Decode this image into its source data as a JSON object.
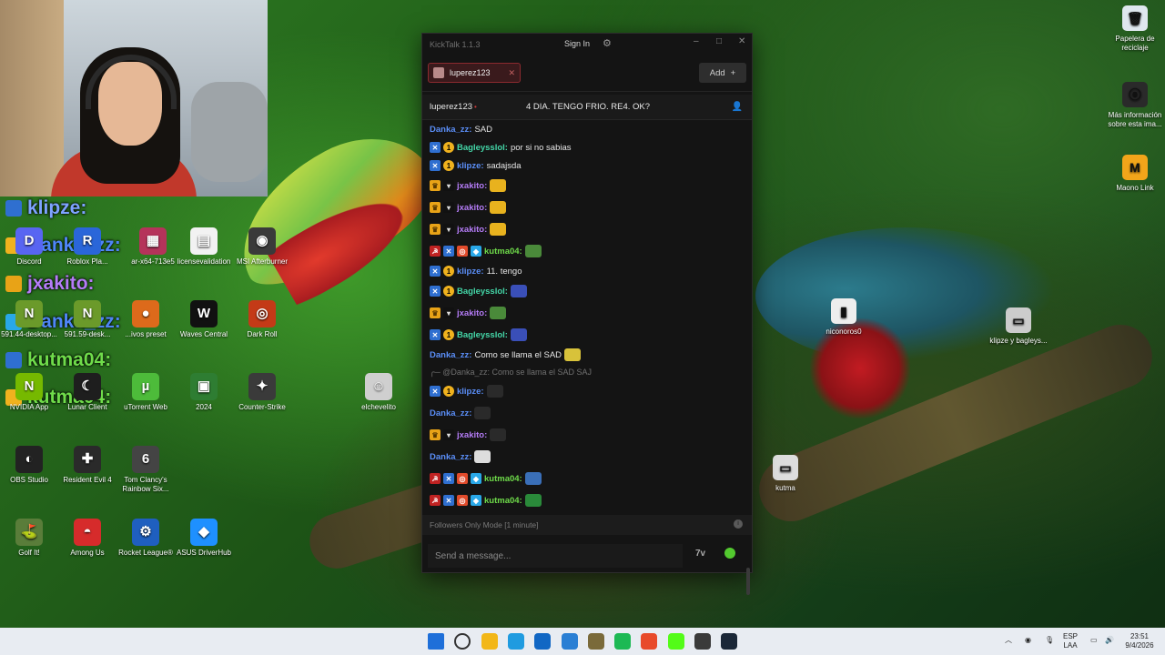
{
  "webcam": {
    "label": "webcam-feed"
  },
  "overlay": {
    "rows": [
      {
        "name": "klipze:",
        "color": "#7ea3ff"
      },
      {
        "name": "Danka_zz:",
        "color": "#4f86f7"
      },
      {
        "name": "jxakito:",
        "color": "#b57cf7"
      },
      {
        "name": "Danka_zz:",
        "color": "#4f86f7"
      },
      {
        "name": "kutma04:",
        "color": "#6fdc4a"
      },
      {
        "name": "kutma04:",
        "color": "#6fdc4a"
      }
    ]
  },
  "desktop_left": [
    {
      "label": "Discord",
      "color": "#5865f2",
      "glyph": "D"
    },
    {
      "label": "Roblox Pla...",
      "color": "#2a66d9",
      "glyph": "R"
    },
    {
      "label": "ar-x64-713e5",
      "color": "#b5335a",
      "glyph": "▦"
    },
    {
      "label": "licensevalidation",
      "color": "#f2f2f2",
      "glyph": "▤"
    },
    {
      "label": "MSI Afterburner",
      "color": "#3a3a3a",
      "glyph": "◉"
    },
    {
      "label": "591.44-desktop...",
      "color": "#6b9a2a",
      "glyph": "N"
    },
    {
      "label": "591.59-desk...",
      "color": "#6b9a2a",
      "glyph": "N"
    },
    {
      "label": "...ivos preset",
      "color": "#dd6a1b",
      "glyph": "●"
    },
    {
      "label": "Waves Central",
      "color": "#111111",
      "glyph": "W"
    },
    {
      "label": "Dark Roll",
      "color": "#c43a17",
      "glyph": "◎"
    },
    {
      "label": "NVIDIA App",
      "color": "#76b900",
      "glyph": "N"
    },
    {
      "label": "Lunar Client",
      "color": "#1e1e1e",
      "glyph": "☾"
    },
    {
      "label": "uTorrent Web",
      "color": "#4dbb3a",
      "glyph": "µ"
    },
    {
      "label": "2024",
      "color": "#2e7d32",
      "glyph": "▣"
    },
    {
      "label": "Counter-Strike",
      "color": "#3a3a3a",
      "glyph": "✦"
    },
    {
      "label": "elchevelito",
      "color": "#cfcfcf",
      "glyph": "☺"
    },
    {
      "label": "OBS Studio",
      "color": "#222222",
      "glyph": "◐"
    },
    {
      "label": "Resident Evil 4",
      "color": "#2a2a2a",
      "glyph": "✚"
    },
    {
      "label": "Tom Clancy's Rainbow Six...",
      "color": "#444444",
      "glyph": "6"
    },
    {
      "label": "Golf It!",
      "color": "#5a7d3a",
      "glyph": "⛳"
    },
    {
      "label": "Among Us",
      "color": "#d62b2b",
      "glyph": "◓"
    },
    {
      "label": "Rocket League®",
      "color": "#1f5fbf",
      "glyph": "⚙"
    },
    {
      "label": "ASUS DriverHub",
      "color": "#1e90ff",
      "glyph": "◆"
    }
  ],
  "desktop_right": [
    {
      "label": "Papelera de reciclaje",
      "color": "#dfe7ee",
      "glyph": "🗑"
    },
    {
      "label": "Más información sobre esta ima...",
      "color": "#2a2a2a",
      "glyph": "⦿"
    },
    {
      "label": "Maono Link",
      "color": "#f2a51a",
      "glyph": "M"
    },
    {
      "label": "niconoros0",
      "color": "#eeeeee",
      "glyph": "▮"
    },
    {
      "label": "klipze y bagleys...",
      "color": "#cccccc",
      "glyph": "▭"
    },
    {
      "label": "kutma",
      "color": "#dddddd",
      "glyph": "▭"
    }
  ],
  "kicktalk": {
    "app_title": "KickTalk 1.1.3",
    "sign_in": "Sign In",
    "channel_tab": "luperez123",
    "add_label": "Add",
    "channel_name": "luperez123",
    "stream_title": "4 DIA. TENGO FRIO. RE4. OK?",
    "followers_mode": "Followers Only Mode [1 minute]",
    "input_placeholder": "Send a message...",
    "reply_text": "@Danka_zz: Como se llama el SAD SAJ",
    "messages": [
      {
        "user": "Danka_zz:",
        "text": "SAD",
        "badges": [],
        "ucls": "u-blue",
        "emote": ""
      },
      {
        "user": "Bagleysslol:",
        "text": "por si no sabias",
        "badges": [
          "x",
          "1"
        ],
        "ucls": "u-green",
        "emote": ""
      },
      {
        "user": "klipze:",
        "text": "sadajsda",
        "badges": [
          "x",
          "1"
        ],
        "ucls": "u-blue",
        "emote": ""
      },
      {
        "user": "jxakito:",
        "text": "",
        "badges": [
          "crown",
          "glass"
        ],
        "ucls": "u-purple",
        "emote": "#e8b21e"
      },
      {
        "user": "jxakito:",
        "text": "",
        "badges": [
          "crown",
          "glass"
        ],
        "ucls": "u-purple",
        "emote": "#e8b21e"
      },
      {
        "user": "jxakito:",
        "text": "",
        "badges": [
          "crown",
          "glass"
        ],
        "ucls": "u-purple",
        "emote": "#e8b21e"
      },
      {
        "user": "kutma04:",
        "text": "",
        "badges": [
          "sub",
          "x",
          "orange",
          "cube"
        ],
        "ucls": "u-lime",
        "emote": "#4a8a3a"
      },
      {
        "user": "klipze:",
        "text": "11. tengo",
        "badges": [
          "x",
          "1"
        ],
        "ucls": "u-blue",
        "emote": ""
      },
      {
        "user": "Bagleysslol:",
        "text": "",
        "badges": [
          "x",
          "1"
        ],
        "ucls": "u-green",
        "emote": "#3a4fb8"
      },
      {
        "user": "jxakito:",
        "text": "",
        "badges": [
          "crown",
          "glass"
        ],
        "ucls": "u-purple",
        "emote": "#4a8a3a"
      },
      {
        "user": "Bagleysslol:",
        "text": "",
        "badges": [
          "x",
          "1"
        ],
        "ucls": "u-green",
        "emote": "#3a4fb8"
      },
      {
        "user": "Danka_zz:",
        "text": "Como se llama el SAD",
        "badges": [],
        "ucls": "u-blue",
        "emote": "#d8c23a"
      },
      {
        "user": "klipze:",
        "text": "",
        "badges": [
          "x",
          "1"
        ],
        "ucls": "u-blue",
        "emote": "#2a2a2a"
      },
      {
        "user": "Danka_zz:",
        "text": "",
        "badges": [],
        "ucls": "u-blue",
        "emote": "#2a2a2a"
      },
      {
        "user": "jxakito:",
        "text": "",
        "badges": [
          "crown",
          "glass"
        ],
        "ucls": "u-purple",
        "emote": "#2a2a2a"
      },
      {
        "user": "Danka_zz:",
        "text": "",
        "badges": [],
        "ucls": "u-blue",
        "emote": "#dddddd"
      },
      {
        "user": "kutma04:",
        "text": "",
        "badges": [
          "sub",
          "x",
          "orange",
          "cube"
        ],
        "ucls": "u-lime",
        "emote": "#3a6fb8"
      },
      {
        "user": "kutma04:",
        "text": "",
        "badges": [
          "sub",
          "x",
          "orange",
          "cube"
        ],
        "ucls": "u-lime",
        "emote": "#2a8a3a"
      }
    ]
  },
  "taskbar": {
    "lang_line1": "ESP",
    "lang_line2": "LAA",
    "time": "23:51",
    "date": "9/4/2026",
    "icons": [
      "#1e6fd9",
      "#333333",
      "#f2b718",
      "#1f9be0",
      "#1167c4",
      "#2a7fd4",
      "#7a6a3a",
      "#1db954",
      "#e84a2a",
      "#53fc18",
      "#3a3a3a",
      "#1b2838"
    ]
  }
}
